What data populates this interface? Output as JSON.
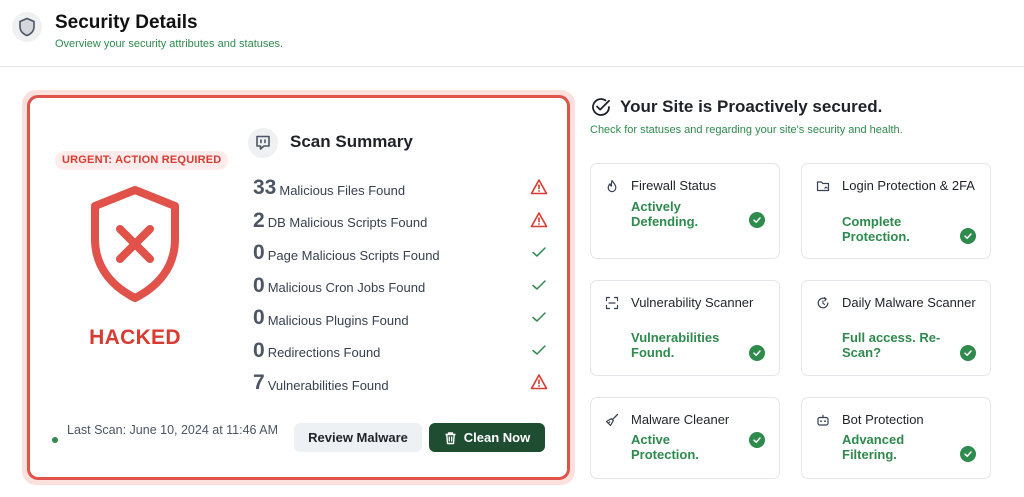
{
  "header": {
    "title": "Security Details",
    "subtitle": "Overview your security attributes and statuses.",
    "icon": "shield-icon"
  },
  "alert": {
    "badge": "URGENT: ACTION REQUIRED",
    "status_label": "HACKED",
    "colors": {
      "danger": "#d93a31",
      "success": "#2f8a4e",
      "primary_button": "#1f4d31"
    }
  },
  "scan_summary": {
    "title": "Scan Summary",
    "items": [
      {
        "count": "33",
        "label": "Malicious Files Found",
        "status": "warning"
      },
      {
        "count": "2",
        "label": "DB Malicious Scripts Found",
        "status": "warning"
      },
      {
        "count": "0",
        "label": "Page Malicious Scripts Found",
        "status": "ok"
      },
      {
        "count": "0",
        "label": "Malicious Cron Jobs Found",
        "status": "ok"
      },
      {
        "count": "0",
        "label": "Malicious Plugins Found",
        "status": "ok"
      },
      {
        "count": "0",
        "label": "Redirections Found",
        "status": "ok"
      },
      {
        "count": "7",
        "label": "Vulnerabilities Found",
        "status": "warning"
      }
    ],
    "last_scan": "Last Scan: June 10, 2024 at 11:46 AM",
    "review_button": "Review Malware",
    "clean_button": "Clean Now"
  },
  "site_status": {
    "title": "Your Site is Proactively secured.",
    "subtitle": "Check for statuses and regarding your site's security and health.",
    "features": [
      {
        "title": "Firewall Status",
        "status": "Actively Defending.",
        "icon": "flame-icon"
      },
      {
        "title": "Login Protection & 2FA",
        "status": "Complete Protection.",
        "icon": "folder-lock-icon"
      },
      {
        "title": "Vulnerability Scanner",
        "status": "Vulnerabilities Found.",
        "icon": "scan-frame-icon"
      },
      {
        "title": "Daily Malware Scanner",
        "status": "Full access. Re-Scan?",
        "icon": "refresh-clock-icon"
      },
      {
        "title": "Malware Cleaner",
        "status": "Active Protection.",
        "icon": "broom-icon"
      },
      {
        "title": "Bot Protection",
        "status": "Advanced Filtering.",
        "icon": "bot-icon"
      }
    ]
  }
}
